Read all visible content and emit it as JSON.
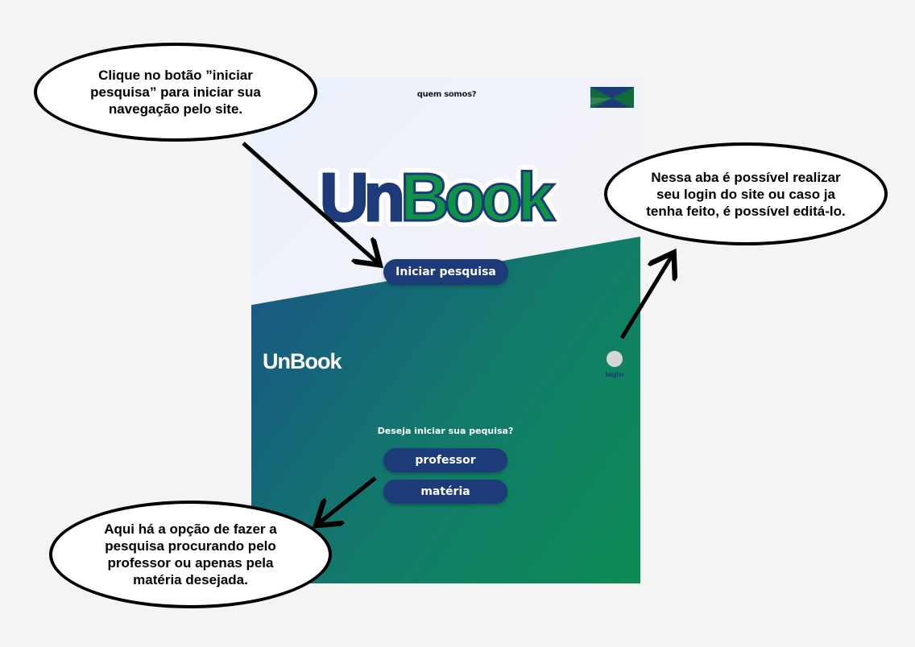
{
  "colors": {
    "background": "#f4f4f4",
    "button": "#1d3b78",
    "logo_blue": "#1d3b78",
    "logo_green": "#0f9447",
    "band_start": "#1b4e8d",
    "band_end": "#0c8c54"
  },
  "header": {
    "nav_link": "quem somos?",
    "unb_logo_icon": "unb-logo-icon"
  },
  "hero": {
    "logo_part1": "Un",
    "logo_part2": "Book",
    "start_button": "Iniciar pesquisa"
  },
  "lower": {
    "small_logo": "UnBook",
    "login_label": "login",
    "prompt": "Deseja iniciar sua pequisa?",
    "option_professor": "professor",
    "option_materia": "matéria"
  },
  "annotations": {
    "bubble_start": "Clique no botão ”iniciar\npesquisa” para iniciar sua\nnavegação pelo site.",
    "bubble_login": "Nessa aba é possível realizar\nseu login do site ou caso ja\ntenha feito, é possível editá-lo.",
    "bubble_search": "Aqui há a opção de fazer a\npesquisa procurando pelo\nprofessor ou apenas pela\nmatéria desejada."
  }
}
